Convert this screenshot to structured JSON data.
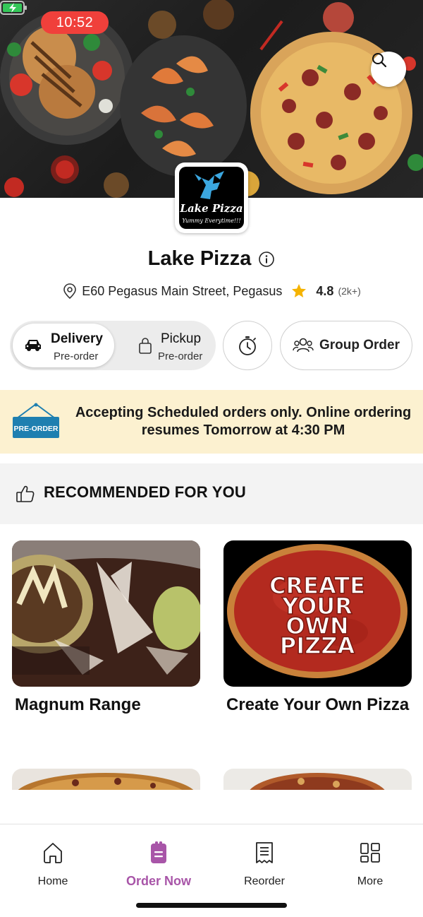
{
  "status_bar": {
    "time": "10:52"
  },
  "restaurant": {
    "logo_name": "Lake Pizza",
    "logo_tagline": "Yummy Everytime!!!",
    "name": "Lake Pizza",
    "address": "E60 Pegasus Main Street, Pegasus",
    "rating": "4.8",
    "rating_count": "(2k+)"
  },
  "order_mode": {
    "delivery_label": "Delivery",
    "delivery_sub": "Pre-order",
    "pickup_label": "Pickup",
    "pickup_sub": "Pre-order",
    "selected": "Delivery"
  },
  "group_order_label": "Group Order",
  "banner": {
    "sign_label": "PRE-ORDER",
    "message": "Accepting Scheduled orders only. Online ordering resumes Tomorrow at 4:30 PM"
  },
  "recommended": {
    "title": "RECOMMENDED FOR YOU",
    "items": [
      {
        "title": "Magnum Range"
      },
      {
        "title": "Create Your Own Pizza",
        "image_text": [
          "CREATE",
          "YOUR",
          "OWN",
          "PIZZA"
        ]
      }
    ]
  },
  "nav": {
    "items": [
      {
        "label": "Home",
        "icon": "home-icon"
      },
      {
        "label": "Order Now",
        "icon": "order-icon"
      },
      {
        "label": "Reorder",
        "icon": "receipt-icon"
      },
      {
        "label": "More",
        "icon": "grid-icon"
      }
    ],
    "active": "Order Now"
  },
  "colors": {
    "accent": "#a855a8",
    "banner_bg": "#fcf1d0",
    "status_time_bg": "#f0403b",
    "star": "#f5b301"
  }
}
